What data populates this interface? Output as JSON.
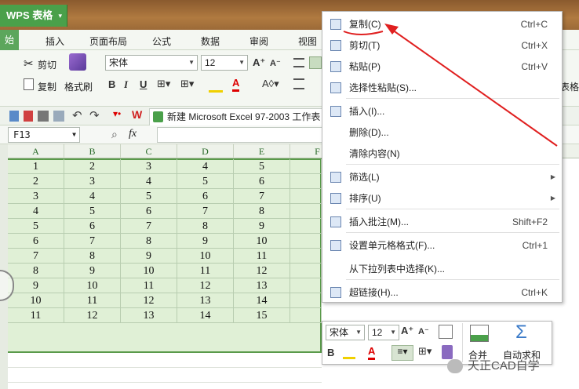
{
  "app": {
    "title": "WPS 表格"
  },
  "menu": {
    "tabs": [
      "始",
      "插入",
      "页面布局",
      "公式",
      "数据",
      "审阅",
      "视图"
    ]
  },
  "ribbon": {
    "cut": "剪切",
    "copy": "复制",
    "format_painter": "格式刷",
    "font": "宋体",
    "size": "12",
    "right_label": "表格"
  },
  "doc_tab": "新建 Microsoft Excel 97-2003 工作表",
  "formula": {
    "namebox": "F13",
    "fx": "fx"
  },
  "columns": [
    "A",
    "B",
    "C",
    "D",
    "E",
    "F"
  ],
  "table": [
    [
      1,
      2,
      3,
      4,
      5
    ],
    [
      2,
      3,
      4,
      5,
      6
    ],
    [
      3,
      4,
      5,
      6,
      7
    ],
    [
      4,
      5,
      6,
      7,
      8
    ],
    [
      5,
      6,
      7,
      8,
      9
    ],
    [
      6,
      7,
      8,
      9,
      10
    ],
    [
      7,
      8,
      9,
      10,
      11
    ],
    [
      8,
      9,
      10,
      11,
      12
    ],
    [
      9,
      10,
      11,
      12,
      13
    ],
    [
      10,
      11,
      12,
      13,
      14
    ],
    [
      11,
      12,
      13,
      14,
      15
    ]
  ],
  "context_menu": [
    {
      "label": "复制(C)",
      "shortcut": "Ctrl+C",
      "icon": "copy-icon"
    },
    {
      "label": "剪切(T)",
      "shortcut": "Ctrl+X",
      "icon": "scissors-icon"
    },
    {
      "label": "粘贴(P)",
      "shortcut": "Ctrl+V",
      "icon": "paste-icon"
    },
    {
      "label": "选择性粘贴(S)...",
      "shortcut": "",
      "icon": "paste-special-icon"
    },
    {
      "label": "插入(I)...",
      "shortcut": "",
      "icon": "insert-icon"
    },
    {
      "label": "删除(D)...",
      "shortcut": "",
      "icon": ""
    },
    {
      "label": "清除内容(N)",
      "shortcut": "",
      "icon": ""
    },
    {
      "label": "筛选(L)",
      "shortcut": "",
      "icon": "filter-icon",
      "submenu": true
    },
    {
      "label": "排序(U)",
      "shortcut": "",
      "icon": "sort-icon",
      "submenu": true
    },
    {
      "label": "插入批注(M)...",
      "shortcut": "Shift+F2",
      "icon": "comment-icon"
    },
    {
      "label": "设置单元格格式(F)...",
      "shortcut": "Ctrl+1",
      "icon": "format-cells-icon"
    },
    {
      "label": "从下拉列表中选择(K)...",
      "shortcut": "",
      "icon": ""
    },
    {
      "label": "超链接(H)...",
      "shortcut": "Ctrl+K",
      "icon": "hyperlink-icon"
    }
  ],
  "mini_toolbar": {
    "font": "宋体",
    "size": "12",
    "merge": "合并",
    "autosum": "自动求和"
  },
  "watermark": "天正CAD自学",
  "colors": {
    "accent": "#4aa04a",
    "selection": "#e0f0d6",
    "arrow": "#e02020"
  }
}
